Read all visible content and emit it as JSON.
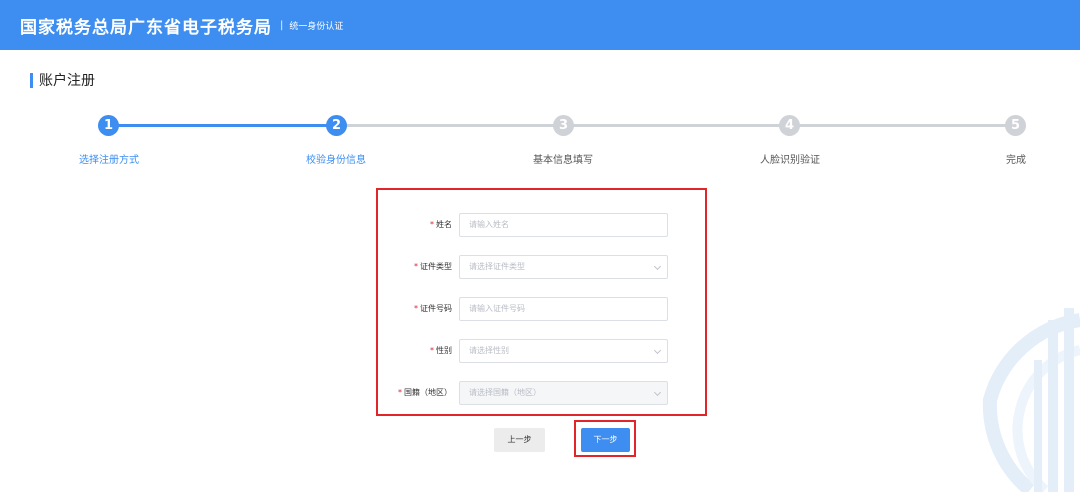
{
  "header": {
    "brand": "国家税务总局广东省电子税务局",
    "separator": "|",
    "subtitle": "统一身份认证"
  },
  "page": {
    "section_title": "账户注册"
  },
  "steps": [
    {
      "number": "1",
      "label": "选择注册方式",
      "state": "done"
    },
    {
      "number": "2",
      "label": "校验身份信息",
      "state": "current"
    },
    {
      "number": "3",
      "label": "基本信息填写",
      "state": "todo"
    },
    {
      "number": "4",
      "label": "人脸识别验证",
      "state": "todo"
    },
    {
      "number": "5",
      "label": "完成",
      "state": "todo"
    }
  ],
  "form": {
    "required_mark": "*",
    "name": {
      "label": "姓名",
      "placeholder": "请输入姓名"
    },
    "id_type": {
      "label": "证件类型",
      "placeholder": "请选择证件类型"
    },
    "id_number": {
      "label": "证件号码",
      "placeholder": "请输入证件号码"
    },
    "gender": {
      "label": "性别",
      "placeholder": "请选择性别"
    },
    "nationality": {
      "label": "国籍（地区）",
      "placeholder": "请选择国籍（地区）"
    }
  },
  "buttons": {
    "prev": "上一步",
    "next": "下一步"
  },
  "colors": {
    "primary": "#3d8ef0",
    "highlight": "#e0262a",
    "inactive_step": "#cfd2d6"
  }
}
